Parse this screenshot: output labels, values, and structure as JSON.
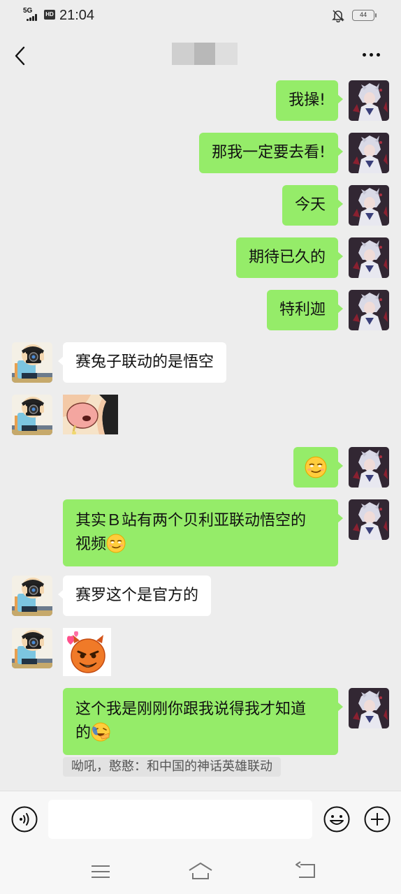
{
  "status_bar": {
    "network": "5G",
    "hd": "HD",
    "time": "21:04",
    "battery": "44"
  },
  "header": {
    "title": ""
  },
  "messages": [
    {
      "side": "self",
      "text": "我操!"
    },
    {
      "side": "self",
      "text": "那我一定要去看!"
    },
    {
      "side": "self",
      "text": "今天"
    },
    {
      "side": "self",
      "text": "期待已久的"
    },
    {
      "side": "self",
      "text": "特利迦"
    },
    {
      "side": "other",
      "text": "赛兔子联动的是悟空"
    },
    {
      "side": "other",
      "type": "sticker",
      "sticker": "cartoon-nose-closeup"
    },
    {
      "side": "self",
      "type": "emoji",
      "emoji": "smirk-face"
    },
    {
      "side": "self",
      "text_line1": "其实Ｂ站有两个贝利亚联动悟空的",
      "text_line2": "视频",
      "emoji": "smirk-face"
    },
    {
      "side": "other",
      "text": "赛罗这个是官方的"
    },
    {
      "side": "other",
      "type": "sticker",
      "sticker": "devil-face-hearts"
    },
    {
      "side": "self",
      "text_line1": "这个我是刚刚你跟我说得我才知道",
      "text_line2": "的",
      "emoji": "facepalm-laugh"
    }
  ],
  "quote": "呦吼，憨憨：和中国的神话英雄联动",
  "input_bar": {
    "placeholder": ""
  },
  "colors": {
    "background": "#ededed",
    "self_bubble": "#95ec69",
    "other_bubble": "#ffffff"
  }
}
